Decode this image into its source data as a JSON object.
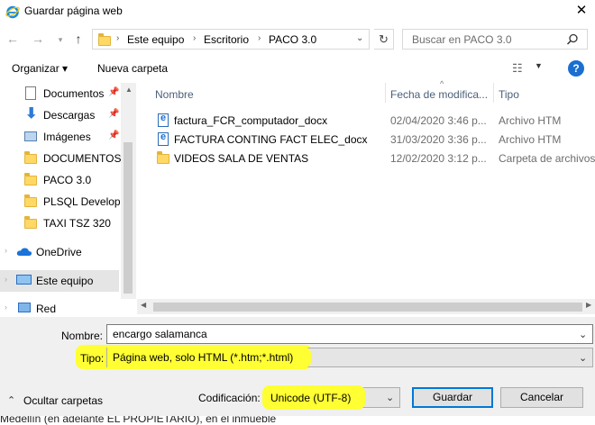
{
  "window": {
    "title": "Guardar página web",
    "close": "✕"
  },
  "nav": {
    "breadcrumb": [
      "Este equipo",
      "Escritorio",
      "PACO 3.0"
    ],
    "search_placeholder": "Buscar en PACO 3.0"
  },
  "toolbar": {
    "organize": "Organizar ▾",
    "new_folder": "Nueva carpeta"
  },
  "sidebar": {
    "items": [
      {
        "label": "Documentos",
        "icon": "documents-icon",
        "pinned": true
      },
      {
        "label": "Descargas",
        "icon": "downloads-icon",
        "pinned": true
      },
      {
        "label": "Imágenes",
        "icon": "pictures-icon",
        "pinned": true
      },
      {
        "label": "DOCUMENTOS P",
        "icon": "folder-icon"
      },
      {
        "label": "PACO 3.0",
        "icon": "folder-icon"
      },
      {
        "label": "PLSQL Develope",
        "icon": "folder-icon"
      },
      {
        "label": "TAXI TSZ 320",
        "icon": "folder-icon"
      },
      {
        "label": "OneDrive",
        "icon": "onedrive-icon"
      },
      {
        "label": "Este equipo",
        "icon": "this-pc-icon",
        "selected": true
      },
      {
        "label": "Red",
        "icon": "network-icon"
      }
    ]
  },
  "file_list": {
    "columns": [
      "Nombre",
      "Fecha de modifica...",
      "Tipo"
    ],
    "rows": [
      {
        "name": "factura_FCR_computador_docx",
        "date": "02/04/2020 3:46 p...",
        "type": "Archivo HTM",
        "icon": "html-file-icon"
      },
      {
        "name": "FACTURA CONTING FACT ELEC_docx",
        "date": "31/03/2020 3:36 p...",
        "type": "Archivo HTM",
        "icon": "html-file-icon"
      },
      {
        "name": "VIDEOS SALA DE VENTAS",
        "date": "12/02/2020 3:12 p...",
        "type": "Carpeta de archivos",
        "icon": "folder-icon"
      }
    ]
  },
  "form": {
    "name_label": "Nombre:",
    "name_value": "encargo salamanca",
    "type_label": "Tipo:",
    "type_value": "Página web, solo HTML (*.htm;*.html)",
    "encoding_label": "Codificación:",
    "encoding_value": "Unicode (UTF-8)",
    "hide_folders": "Ocultar carpetas",
    "save": "Guardar",
    "cancel": "Cancelar"
  },
  "background_text": "Medellín (en adelante EL PROPIETARIO), en el inmueble",
  "colors": {
    "accent": "#0078d7",
    "highlight": "#ffff33",
    "selected_bg": "#e5e5e5"
  }
}
